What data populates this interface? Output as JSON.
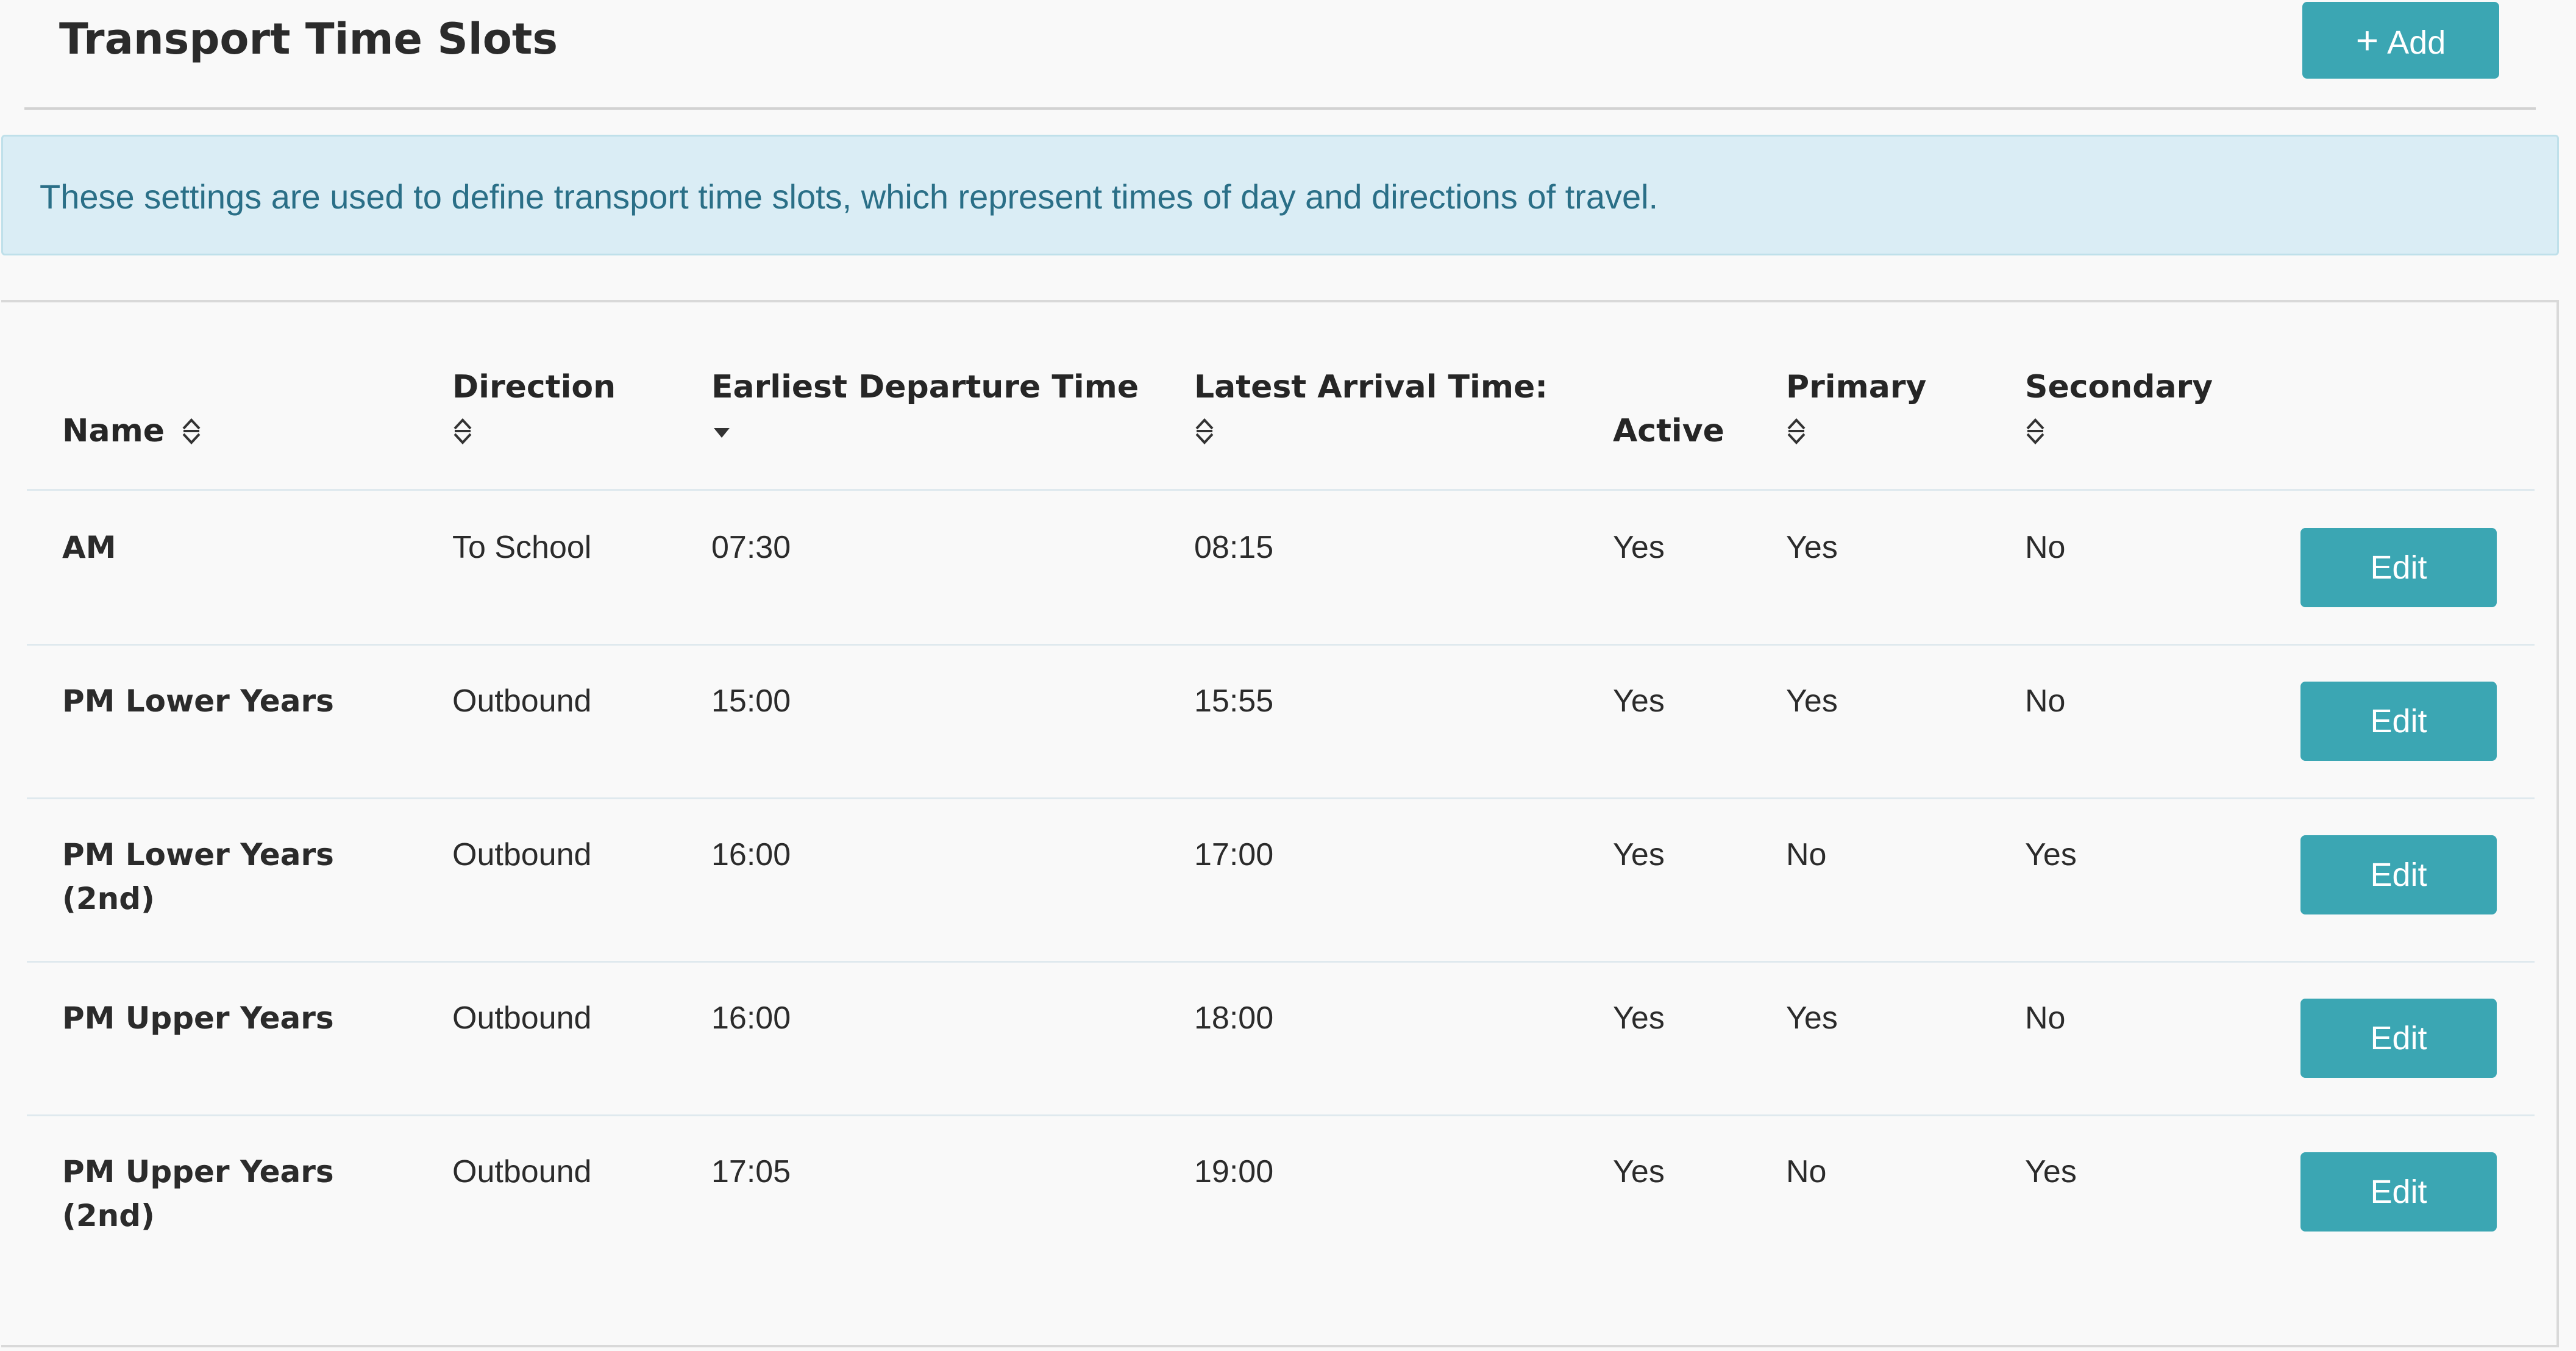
{
  "header": {
    "title": "Transport Time Slots",
    "add_label": "Add"
  },
  "info": {
    "text": "These settings are used to define transport time slots, which represent times of day and directions of travel."
  },
  "table": {
    "columns": [
      {
        "label": "Name",
        "sort": "both"
      },
      {
        "label": "Direction",
        "sort": "both"
      },
      {
        "label": "Earliest Departure Time",
        "sort": "desc"
      },
      {
        "label": "Latest Arrival Time:",
        "sort": "both"
      },
      {
        "label": "Active",
        "sort": "none"
      },
      {
        "label": "Primary",
        "sort": "both"
      },
      {
        "label": "Secondary",
        "sort": "both"
      }
    ],
    "edit_label": "Edit",
    "rows": [
      {
        "name_line1": "AM",
        "name_line2": "",
        "direction": "To School",
        "departure": "07:30",
        "arrival": "08:15",
        "active": "Yes",
        "primary": "Yes",
        "secondary": "No"
      },
      {
        "name_line1": "PM Lower Years",
        "name_line2": "",
        "direction": "Outbound",
        "departure": "15:00",
        "arrival": "15:55",
        "active": "Yes",
        "primary": "Yes",
        "secondary": "No"
      },
      {
        "name_line1": "PM Lower Years",
        "name_line2": "(2nd)",
        "direction": "Outbound",
        "departure": "16:00",
        "arrival": "17:00",
        "active": "Yes",
        "primary": "No",
        "secondary": "Yes"
      },
      {
        "name_line1": "PM Upper Years",
        "name_line2": "",
        "direction": "Outbound",
        "departure": "16:00",
        "arrival": "18:00",
        "active": "Yes",
        "primary": "Yes",
        "secondary": "No"
      },
      {
        "name_line1": "PM Upper Years",
        "name_line2": "(2nd)",
        "direction": "Outbound",
        "departure": "17:05",
        "arrival": "19:00",
        "active": "Yes",
        "primary": "No",
        "secondary": "Yes"
      }
    ]
  },
  "colors": {
    "accent": "#3ba6b3",
    "info_bg": "#daedf5",
    "info_text": "#2a6f87"
  }
}
